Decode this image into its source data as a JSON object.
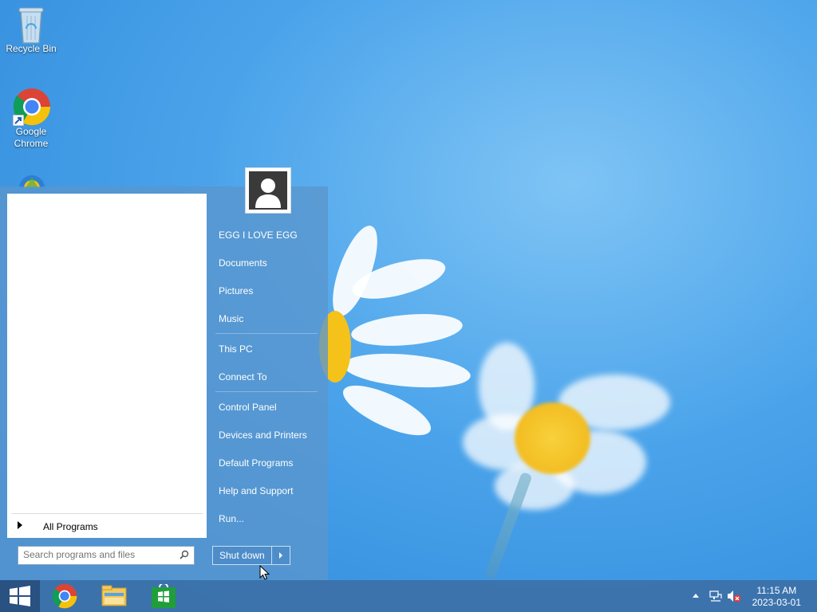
{
  "desktop": {
    "icons": [
      {
        "label": "Recycle Bin",
        "icon": "recycle-bin-icon"
      },
      {
        "label": "Google Chrome",
        "icon": "chrome-icon"
      },
      {
        "label": "",
        "icon": "ie-icon"
      }
    ]
  },
  "start_menu": {
    "all_programs_label": "All Programs",
    "search_placeholder": "Search programs and files",
    "user_name": "EGG I LOVE EGG",
    "right_items": [
      "Documents",
      "Pictures",
      "Music",
      "This PC",
      "Connect To",
      "Control Panel",
      "Devices and Printers",
      "Default Programs",
      "Help and Support",
      "Run..."
    ],
    "shutdown_label": "Shut down"
  },
  "taskbar": {
    "pinned": [
      "windows-start-icon",
      "chrome-icon",
      "file-explorer-icon",
      "store-icon"
    ],
    "time": "11:15 AM",
    "date": "2023-03-01"
  },
  "colors": {
    "accent": "#3c6ea5",
    "start_menu": "#5a96cd"
  }
}
